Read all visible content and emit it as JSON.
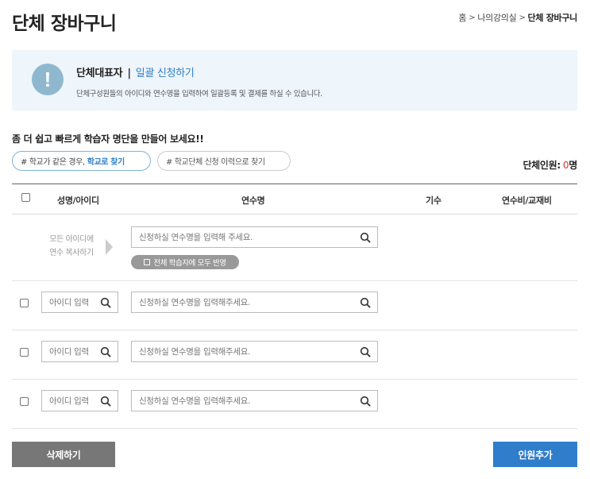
{
  "page": {
    "title": "단체 장바구니"
  },
  "breadcrumb": {
    "home": "홈",
    "sep": ">",
    "parent": "나의강의실",
    "current": "단체 장바구니"
  },
  "info": {
    "icon_glyph": "!",
    "title": "단체대표자",
    "divider": "|",
    "title_accent": "일괄 신청하기",
    "description": "단체구성원들의 아이디와 연수명을 입력하여 일괄등록 및 결제를 하실 수 있습니다."
  },
  "lead": "좀 더 쉽고 빠르게 학습자 명단을 만들어 보세요!!",
  "pills": {
    "school_prefix": "# 학교가 같은 경우,",
    "school_accent": "학교로 찾기",
    "history": "# 학교단체 신청 이력으로 찾기"
  },
  "count": {
    "label": "단체인원:",
    "value": "0",
    "unit": "명"
  },
  "table": {
    "headers": {
      "name_id": "성명/아이디",
      "course": "연수명",
      "term": "기수",
      "fee": "연수비/교재비"
    },
    "copy_row": {
      "line1": "모든 아이디에",
      "line2": "연수 복사하기",
      "course_placeholder": "신청하실 연수명을 입력해 주세요.",
      "apply_label": "전체 학습자에 모두 반영"
    },
    "rows": [
      {
        "id_placeholder": "아이디 입력",
        "course_placeholder": "신청하실 연수명을 입력해주세요."
      },
      {
        "id_placeholder": "아이디 입력",
        "course_placeholder": "신청하실 연수명을 입력해주세요."
      },
      {
        "id_placeholder": "아이디 입력",
        "course_placeholder": "신청하실 연수명을 입력해주세요."
      }
    ]
  },
  "buttons": {
    "delete": "삭제하기",
    "add": "인원추가"
  },
  "colors": {
    "accent": "#2f80c8",
    "count": "#e0322d",
    "info_bg": "#eef5fb",
    "delete_bg": "#777777",
    "add_bg": "#2f7dcb"
  }
}
